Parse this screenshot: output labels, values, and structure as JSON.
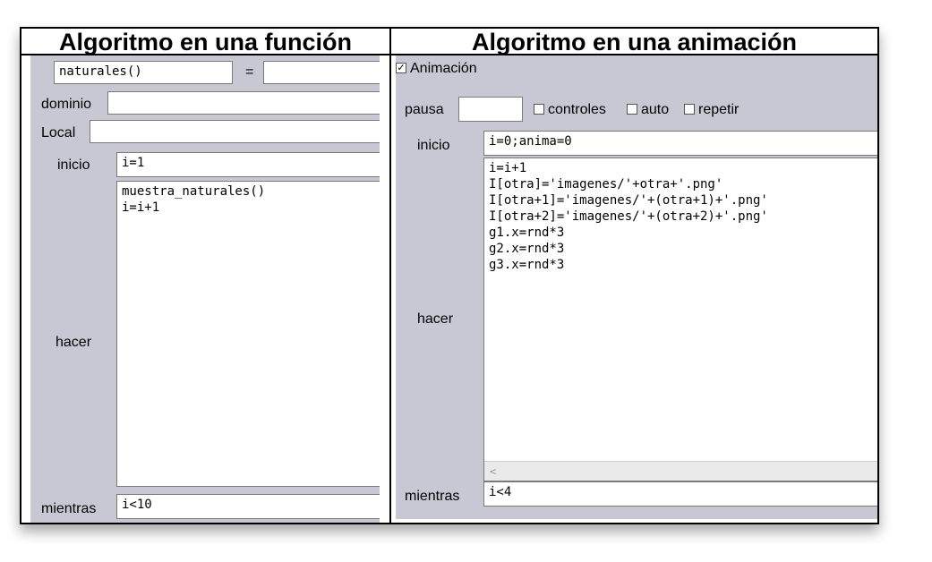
{
  "left": {
    "title": "Algoritmo en una función",
    "name_field": "naturales()",
    "equals": "=",
    "expr_field": "",
    "dominio_label": "dominio",
    "dominio_value": "",
    "local_label": "Local",
    "local_value": "",
    "inicio_label": "inicio",
    "inicio_value": "i=1",
    "hacer_label": "hacer",
    "hacer_lines": [
      "muestra_naturales()",
      "i=i+1"
    ],
    "mientras_label": "mientras",
    "mientras_value": "i<10"
  },
  "right": {
    "title": "Algoritmo en una animación",
    "animacion_label": "Animación",
    "animacion_checked": true,
    "pausa_label": "pausa",
    "pausa_value": "",
    "controles_label": "controles",
    "auto_label": "auto",
    "repetir_label": "repetir",
    "inicio_label": "inicio",
    "inicio_value": "i=0;anima=0",
    "hacer_label": "hacer",
    "hacer_lines": [
      "i=i+1",
      "I[otra]='imagenes/'+otra+'.png'",
      "I[otra+1]='imagenes/'+(otra+1)+'.png'",
      "I[otra+2]='imagenes/'+(otra+2)+'.png'",
      "g1.x=rnd*3",
      "g2.x=rnd*3",
      "g3.x=rnd*3"
    ],
    "scroll_arrow": "<",
    "mientras_label": "mientras",
    "mientras_value": "i<4"
  },
  "colors": {
    "panel": "#c8c8d4",
    "border": "#000000"
  },
  "icons": {
    "checkbox_checked": "checkmark-icon",
    "scroll_left": "scroll-left-arrow-icon"
  }
}
